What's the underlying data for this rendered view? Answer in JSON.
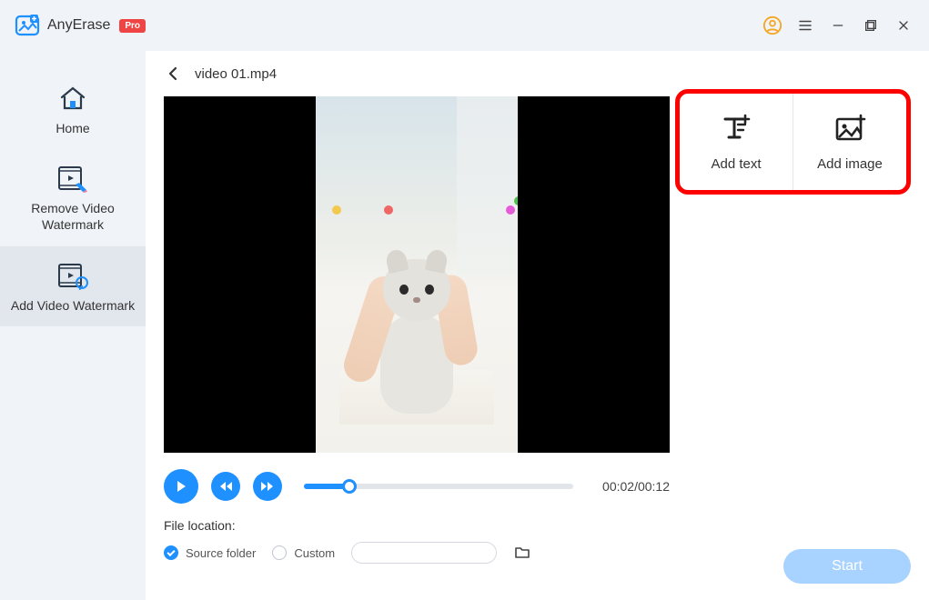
{
  "titlebar": {
    "app_name": "AnyErase",
    "pro_label": "Pro"
  },
  "sidebar": {
    "items": [
      {
        "label": "Home"
      },
      {
        "label": "Remove Video Watermark"
      },
      {
        "label": "Add Video Watermark"
      }
    ]
  },
  "breadcrumb": {
    "filename": "video 01.mp4"
  },
  "side_panel": {
    "add_text_label": "Add text",
    "add_image_label": "Add image"
  },
  "player": {
    "time": "00:02/00:12",
    "progress_percent": "17"
  },
  "file_location": {
    "title": "File location:",
    "source_folder_label": "Source folder",
    "custom_label": "Custom"
  },
  "footer": {
    "start_label": "Start"
  }
}
